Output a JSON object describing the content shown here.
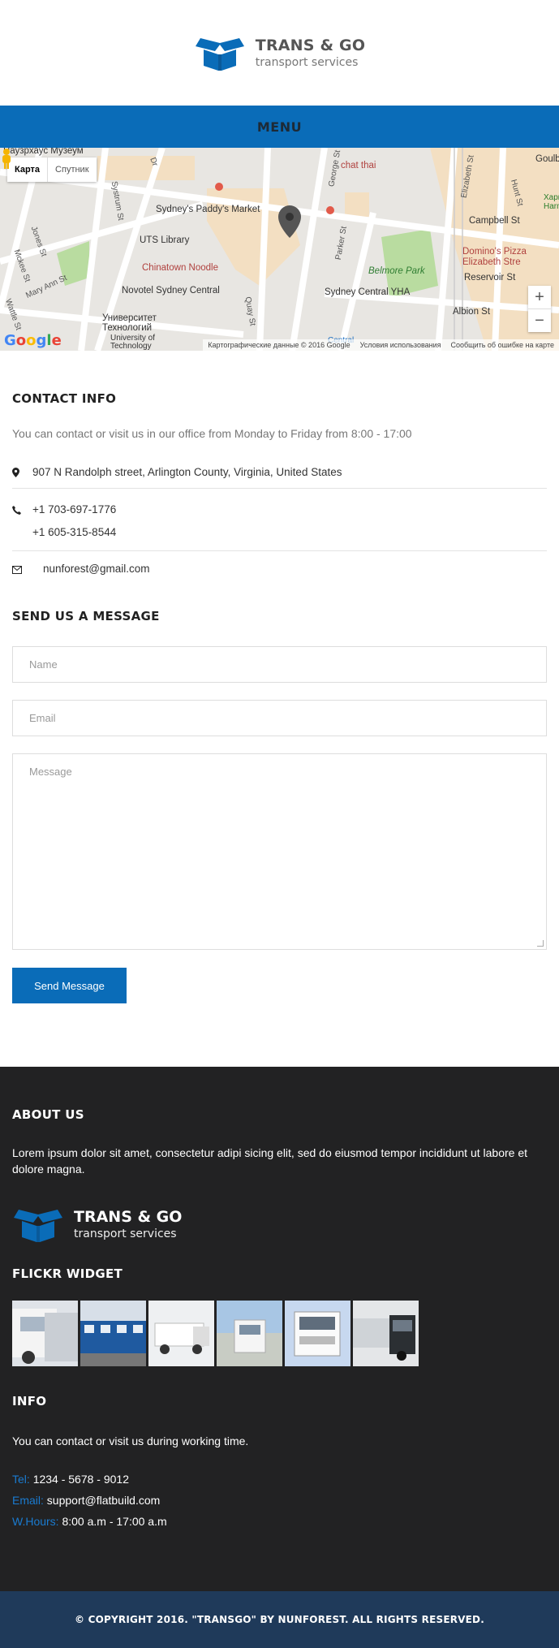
{
  "header": {
    "logo_line1": "TRANS & GO",
    "logo_line2": "transport services"
  },
  "menu": {
    "label": "MENU"
  },
  "map": {
    "toggle_map": "Карта",
    "toggle_satellite": "Спутник",
    "labels": {
      "museum": "Паузрхаус Музеум",
      "chat_thai": "chat thai",
      "paddys": "Sydney's Paddy's Market",
      "uts": "UTS Library",
      "chinatown": "Chinatown Noodle",
      "novotel": "Novotel Sydney Central",
      "university": "Университет\nТехнологий",
      "uni_en": "University of\nTechnology",
      "belmore": "Belmore Park",
      "yha": "Sydney Central YHA",
      "dominos": "Domino's Pizza\nElizabeth Stre",
      "reservoir": "Reservoir St",
      "campbell": "Campbell St",
      "albion": "Albion St",
      "goulburn": "Goulb",
      "harm": "Харм\nHarm",
      "central": "Central"
    },
    "streets": [
      "Systrum St",
      "Jones St",
      "Mary Ann St",
      "Wattle St",
      "Mckee St",
      "Parker St",
      "Quay St",
      "Elizabeth St",
      "Hunt St",
      "George St",
      "Dr"
    ],
    "attribution": "Картографические данные © 2016 Google",
    "terms": "Условия использования",
    "report": "Сообщить об ошибке на карте",
    "google": "Google"
  },
  "contact": {
    "title": "CONTACT INFO",
    "description": "You can contact or visit us in our office from Monday to Friday from 8:00 - 17:00",
    "address": "907 N Randolph street, Arlington County, Virginia, United States",
    "phone1": "+1 703-697-1776",
    "phone2": "+1 605-315-8544",
    "email": "nunforest@gmail.com"
  },
  "form": {
    "title": "SEND US A MESSAGE",
    "name_placeholder": "Name",
    "email_placeholder": "Email",
    "message_placeholder": "Message",
    "submit_label": "Send Message"
  },
  "footer": {
    "about_title": "ABOUT US",
    "about_text": "Lorem ipsum dolor sit amet, consectetur adipi sicing elit, sed do eiusmod tempor incididunt ut labore et dolore magna.",
    "logo_line1": "TRANS & GO",
    "logo_line2": "transport services",
    "flickr_title": "FLICKR WIDGET",
    "info_title": "INFO",
    "info_text": "You can contact or visit us during working time.",
    "tel_key": "Tel:",
    "tel_value": "1234 - 5678 - 9012",
    "email_key": "Email:",
    "email_value": "support@flatbuild.com",
    "hours_key": "W.Hours:",
    "hours_value": "8:00 a.m - 17:00 a.m",
    "copyright": "© COPYRIGHT 2016. \"TRANSGO\" BY NUNFOREST. ALL RIGHTS RESERVED."
  },
  "colors": {
    "brand_blue": "#0a6cb8",
    "footer_bg": "#222223",
    "copyright_bg": "#1f3a5a"
  }
}
